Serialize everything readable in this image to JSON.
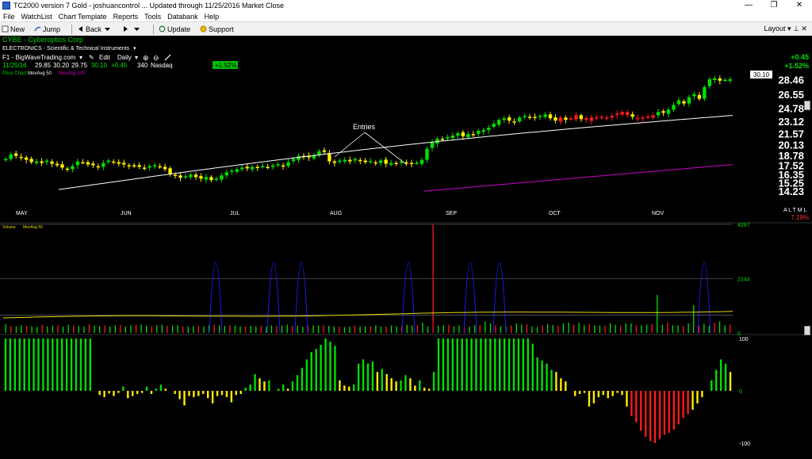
{
  "window": {
    "title": "TC2000 version 7 Gold - joshuancontrol  ... Updated through 11/25/2016  Market Close",
    "minimize": "—",
    "restore": "❐",
    "close": "✕"
  },
  "menu": [
    "File",
    "WatchList",
    "Chart Template",
    "Reports",
    "Tools",
    "Databank",
    "Help"
  ],
  "toolbar": {
    "new": "New",
    "jump": "Jump",
    "back": "Back",
    "forward": "",
    "update": "Update",
    "support": "Support",
    "layout": "Layout"
  },
  "header": {
    "symbol_line": "CYBE - Cyberoptics Corp",
    "industry": "ELECTRONICS - Scientific & Technical Instruments",
    "watchlist": "F1 - BigWaveTrading.com",
    "edit": "Edit",
    "period": "Daily",
    "date": "11/25/16",
    "open": "29.85",
    "high": "30.20",
    "low": "29.75",
    "close": "30.10",
    "change": "+0.45",
    "volume": "340",
    "exchange": "Nasdaq",
    "pct_badge": "+1.52%",
    "legend_price": "Price Chart",
    "legend_ma50": "MovAvg 50",
    "legend_ma200": "MovAvg 200"
  },
  "right_panel": {
    "change": "+0.45",
    "pct": "+1.52%",
    "last_price": "30.10",
    "alert_letters": "A L  T  M  L",
    "pct2": "7.19%"
  },
  "annotation": "Entries",
  "colors": {
    "green": "#00e000",
    "yellow": "#ffee00",
    "red": "#ff1a1a",
    "ma50": "#ffffff",
    "ma200": "#cc00cc",
    "volume_ma": "#e8d800",
    "blue_spike": "#1a1aff"
  },
  "chart_data": [
    {
      "type": "candlestick",
      "title": "CYBE - Cyberoptics Corp",
      "x_labels": [
        "MAY",
        "JUN",
        "JUL",
        "AUG",
        "SEP",
        "OCT",
        "NOV"
      ],
      "y_ticks": [
        28.46,
        26.55,
        24.78,
        23.12,
        21.57,
        20.13,
        18.78,
        17.52,
        16.35,
        15.25,
        14.23
      ],
      "close": [
        18.3,
        18.9,
        18.7,
        18.5,
        18.2,
        17.9,
        18.0,
        17.8,
        18.1,
        17.7,
        17.5,
        17.2,
        17.0,
        17.4,
        18.0,
        17.9,
        17.6,
        17.5,
        17.3,
        17.8,
        18.1,
        17.9,
        17.7,
        17.6,
        17.5,
        17.4,
        17.3,
        17.2,
        17.4,
        17.5,
        17.3,
        17.0,
        16.4,
        16.2,
        15.9,
        16.1,
        16.3,
        16.0,
        15.8,
        16.0,
        15.6,
        15.8,
        16.2,
        16.6,
        16.8,
        17.0,
        17.2,
        17.1,
        17.3,
        17.2,
        17.4,
        17.3,
        17.5,
        17.6,
        17.4,
        17.9,
        18.3,
        18.7,
        18.6,
        18.5,
        18.8,
        19.3,
        19.2,
        18.0,
        17.8,
        18.1,
        18.2,
        18.0,
        18.3,
        18.1,
        17.9,
        18.0,
        17.8,
        18.1,
        17.7,
        17.8,
        17.7,
        18.0,
        17.8,
        17.7,
        17.8,
        18.2,
        19.6,
        20.4,
        20.9,
        20.8,
        21.1,
        21.3,
        21.6,
        21.2,
        21.5,
        21.4,
        21.9,
        22.0,
        22.3,
        22.8,
        23.3,
        23.5,
        23.2,
        23.1,
        23.6,
        23.8,
        23.7,
        23.6,
        23.8,
        24.0,
        23.5,
        23.2,
        23.6,
        23.3,
        23.5,
        23.9,
        23.4,
        23.3,
        23.6,
        23.5,
        23.7,
        23.6,
        23.8,
        24.1,
        24.3,
        23.9,
        23.7,
        23.5,
        23.6,
        23.7,
        23.9,
        24.3,
        24.2,
        24.6,
        25.2,
        25.8,
        25.4,
        26.2,
        26.6,
        26.0,
        27.5,
        28.5,
        28.6,
        28.3,
        28.4,
        28.5
      ],
      "ma50_start": 14.4,
      "ma50_end": 24.7,
      "ma200_start": 14.2,
      "ma200_end": 17.6
    },
    {
      "type": "bar",
      "title": "Volume",
      "y_ticks": [
        4287,
        2144,
        0
      ],
      "values": [
        350,
        280,
        260,
        300,
        270,
        250,
        240,
        320,
        260,
        290,
        300,
        250,
        320,
        300,
        270,
        260,
        340,
        290,
        280,
        300,
        260,
        300,
        320,
        250,
        300,
        310,
        330,
        290,
        270,
        300,
        320,
        280,
        290,
        300,
        260,
        250,
        270,
        280,
        260,
        300,
        330,
        300,
        280,
        300,
        290,
        260,
        250,
        280,
        260,
        290,
        250,
        300,
        270,
        300,
        330,
        280,
        290,
        240,
        280,
        300,
        300,
        300,
        280,
        260,
        250,
        230,
        250,
        290,
        260,
        260,
        260,
        300,
        250,
        250,
        300,
        260,
        280,
        320,
        300,
        310,
        400,
        260,
        4287,
        290,
        310,
        320,
        270,
        290,
        280,
        260,
        300,
        310,
        450,
        380,
        300,
        270,
        260,
        300,
        380,
        330,
        340,
        260,
        240,
        300,
        350,
        310,
        290,
        380,
        410,
        330,
        410,
        300,
        350,
        300,
        290,
        280,
        380,
        320,
        300,
        380,
        380,
        310,
        300,
        330,
        340,
        1500,
        320,
        420,
        310,
        300,
        280,
        380,
        1100,
        300,
        360,
        280,
        400,
        460,
        300,
        330
      ],
      "volume_ma": 700
    },
    {
      "type": "bar",
      "title": "Oscillator",
      "y_ticks": [
        100,
        0,
        -100
      ],
      "values": [
        100,
        100,
        100,
        100,
        100,
        100,
        100,
        100,
        100,
        100,
        100,
        100,
        100,
        100,
        100,
        100,
        100,
        100,
        100,
        0,
        -8,
        -12,
        -5,
        -10,
        -4,
        8,
        -14,
        -10,
        -6,
        -4,
        8,
        -6,
        4,
        12,
        4,
        0,
        -6,
        -16,
        -28,
        -10,
        -12,
        -10,
        -6,
        -14,
        -24,
        -10,
        -8,
        -12,
        -22,
        -8,
        -6,
        6,
        12,
        32,
        24,
        18,
        20,
        0,
        4,
        12,
        4,
        18,
        30,
        44,
        60,
        74,
        80,
        88,
        100,
        94,
        86,
        20,
        10,
        8,
        12,
        52,
        60,
        52,
        56,
        36,
        42,
        32,
        24,
        18,
        20,
        30,
        24,
        10,
        20,
        6,
        4,
        36,
        100,
        100,
        100,
        100,
        100,
        100,
        100,
        100,
        100,
        100,
        100,
        100,
        100,
        100,
        100,
        100,
        100,
        100,
        100,
        100,
        90,
        64,
        58,
        52,
        40,
        36,
        24,
        18,
        0,
        -10,
        -6,
        -4,
        -30,
        -24,
        -12,
        -8,
        -14,
        -10,
        -4,
        -8,
        -30,
        -48,
        -60,
        -76,
        -88,
        -96,
        -100,
        -92,
        -84,
        -80,
        -74,
        -64,
        -52,
        -44,
        -36,
        -24,
        -12,
        0,
        20,
        40,
        60,
        52,
        36
      ]
    }
  ]
}
